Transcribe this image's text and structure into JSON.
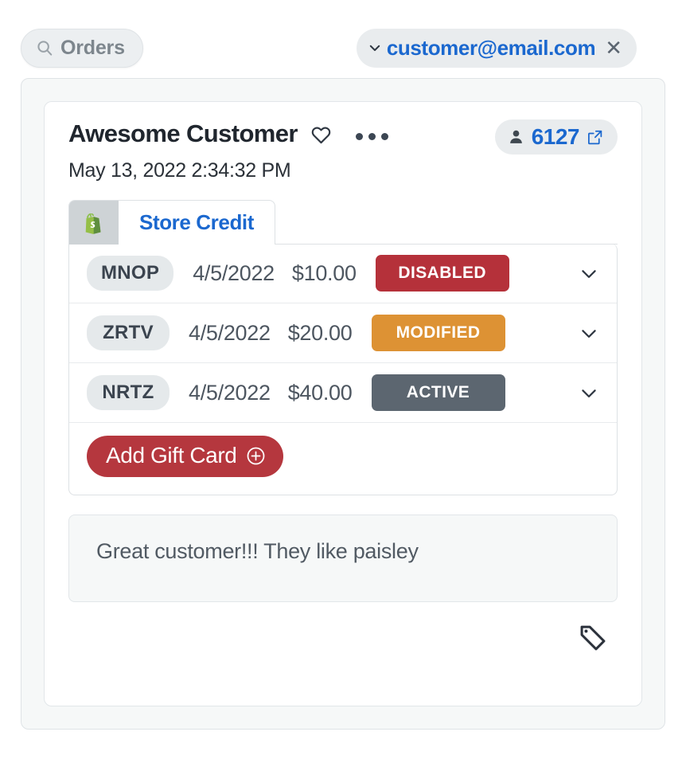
{
  "topbar": {
    "search_label": "Orders",
    "search_icon": "search-icon",
    "email_value": "customer@email.com",
    "caret_icon": "chevron-down-icon",
    "close_label": "✕"
  },
  "customer": {
    "name": "Awesome Customer",
    "timestamp": "May 13, 2022 2:34:32 PM",
    "favorite_icon": "heart-icon",
    "more_icon": "ellipsis-icon",
    "id": "6127",
    "person_icon": "person-icon",
    "external_link_icon": "external-link-icon"
  },
  "tabs": [
    {
      "label": "Store Credit",
      "icon": "shopify-icon",
      "active": true
    }
  ],
  "gift_cards": {
    "rows": [
      {
        "code": "MNOP",
        "date": "4/5/2022",
        "amount": "$10.00",
        "status": "DISABLED",
        "status_color": "#b5313a",
        "expand_icon": "chevron-down-icon"
      },
      {
        "code": "ZRTV",
        "date": "4/5/2022",
        "amount": "$20.00",
        "status": "MODIFIED",
        "status_color": "#dd9234",
        "expand_icon": "chevron-down-icon"
      },
      {
        "code": "NRTZ",
        "date": "4/5/2022",
        "amount": "$40.00",
        "status": "ACTIVE",
        "status_color": "#5c6670",
        "expand_icon": "chevron-down-icon"
      }
    ],
    "add_button_label": "Add Gift Card",
    "add_button_icon": "plus-circle-icon",
    "add_button_color": "#b5373e"
  },
  "note": {
    "text": "Great customer!!! They like paisley"
  },
  "footer": {
    "tag_icon": "tag-icon"
  },
  "colors": {
    "link_blue": "#1b68cf",
    "panel_bg": "#f6f8f8",
    "card_bg": "#ffffff",
    "border": "#dfe3e6"
  }
}
